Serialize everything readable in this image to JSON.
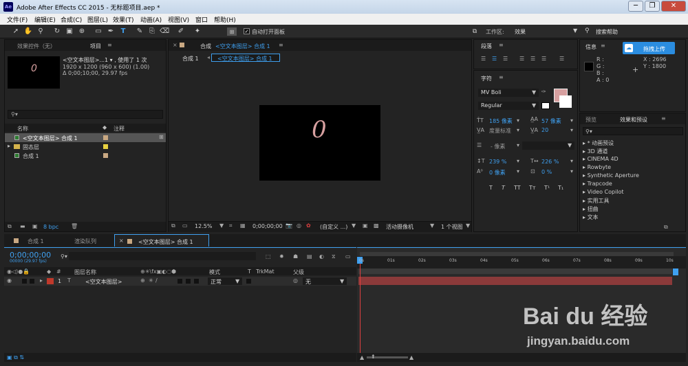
{
  "window": {
    "title": "Adobe After Effects CC 2015 - 无标题项目.aep *",
    "icon": "Ae"
  },
  "menu": [
    "文件(F)",
    "编辑(E)",
    "合成(C)",
    "图层(L)",
    "效果(T)",
    "动画(A)",
    "视图(V)",
    "窗口",
    "帮助(H)"
  ],
  "toolbar": {
    "auto_open": "自动打开面板",
    "workspace_label": "工作区:",
    "workspace": "效果",
    "search_help": "搜索帮助"
  },
  "project": {
    "tab_effects": "效果控件（无）",
    "tab_project": "项目",
    "item_name": "<空文本图层>...1 ▾ , 使用了 1 次",
    "item_dims": "1920 x 1200  (960 x 600) (1.00)",
    "item_dur": "Δ 0;00;10;00, 29.97 fps",
    "col_name": "名称",
    "col_note": "注释",
    "items": [
      "<空文本图层> 合成 1",
      "固态层",
      "合成 1"
    ],
    "bpc": "8 bpc"
  },
  "viewer": {
    "tab_label": "合成",
    "tab_comp": "<空文本图层> 合成 1",
    "crumb1": "合成 1",
    "crumb2": "<空文本图层> 合成 1",
    "zoom": "12.5%",
    "time": "0;00;00;00",
    "custom": "(自定义 ...)",
    "camera": "活动摄像机",
    "views": "1 个视图",
    "canvas_text": "0"
  },
  "paragraph": {
    "title": "段落"
  },
  "character": {
    "title": "字符",
    "font": "MV Boli",
    "style": "Regular",
    "size": "185 像素",
    "leading": "57 像素",
    "kerning": "度量标准",
    "tracking": "20",
    "stroke": "- 像素",
    "vscale": "239 %",
    "hscale": "226 %",
    "baseline": "0 像素",
    "tsume": "0 %"
  },
  "info": {
    "title": "信息",
    "upload": "拖拽上传",
    "r": "R :",
    "g": "G :",
    "b": "B :",
    "a": "A : 0",
    "x": "X : 2696",
    "y": "Y : 1800"
  },
  "effects": {
    "tab_preview": "预览",
    "tab_effects": "效果和预设",
    "items": [
      "* 动画预设",
      "3D 通道",
      "CINEMA 4D",
      "Rowbyte",
      "Synthetic Aperture",
      "Trapcode",
      "Video Copilot",
      "实用工具",
      "扭曲",
      "文本"
    ]
  },
  "timeline": {
    "tab1": "合成 1",
    "tab2": "渲染队列",
    "tab3": "<空文本图层> 合成 1",
    "time": "0;00;00;00",
    "fps": "00000 (29.97 fps)",
    "col_source": "图层名称",
    "col_mode": "模式",
    "col_t": "T",
    "col_trkmat": "TrkMat",
    "col_parent": "父级",
    "layer_num": "1",
    "layer_name": "<空文本图层>",
    "layer_mode": "正常",
    "layer_parent": "无",
    "ticks": [
      "0s",
      "01s",
      "02s",
      "03s",
      "04s",
      "05s",
      "06s",
      "07s",
      "08s",
      "09s",
      "10s"
    ]
  },
  "watermark": {
    "brand": "Bai du 经验",
    "url": "jingyan.baidu.com"
  },
  "colors": {
    "accent": "#3fa0f0",
    "layer_bar": "#8b3a3a",
    "label_red": "#c0392b",
    "swatch": "#d7a0a0"
  }
}
